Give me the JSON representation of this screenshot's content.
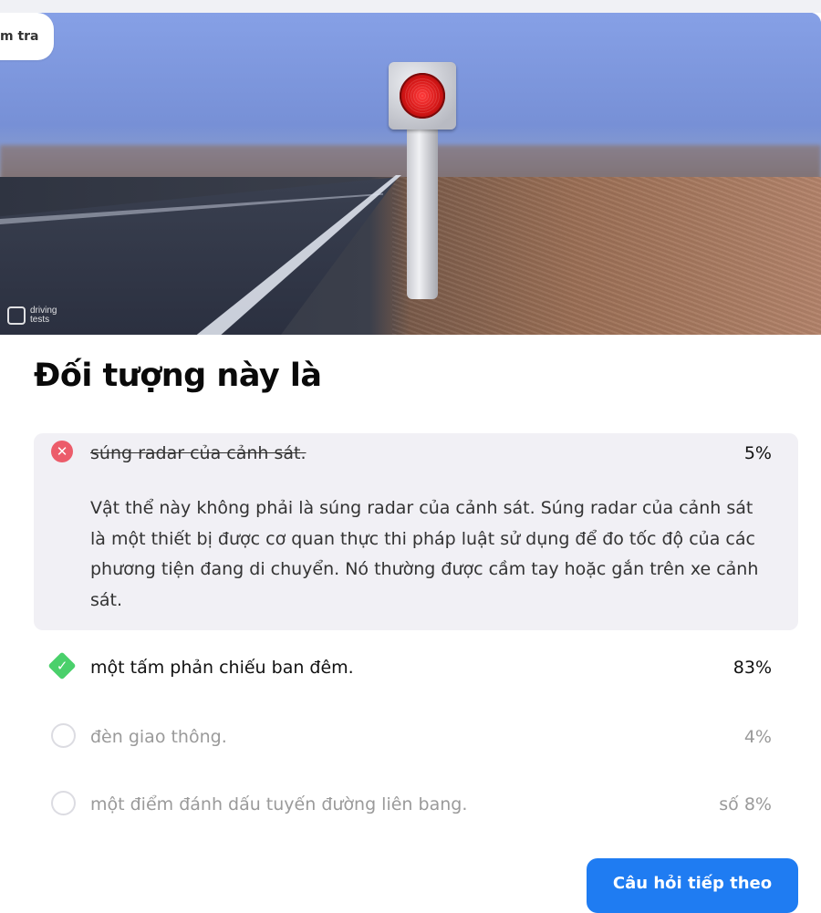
{
  "header": {
    "back_label": "m tra"
  },
  "image": {
    "watermark_line1": "driving",
    "watermark_line2": "tests"
  },
  "question": {
    "text": "Đối tượng này là"
  },
  "answers": [
    {
      "label": "súng radar của cảnh sát.",
      "percent": "5%",
      "state": "wrong",
      "explanation": "Vật thể này không phải là súng radar của cảnh sát. Súng radar của cảnh sát là một thiết bị được cơ quan thực thi pháp luật sử dụng để đo tốc độ của các phương tiện đang di chuyển. Nó thường được cầm tay hoặc gắn trên xe cảnh sát."
    },
    {
      "label": "một tấm phản chiếu ban đêm.",
      "percent": "83%",
      "state": "correct"
    },
    {
      "label": "đèn giao thông.",
      "percent": "4%",
      "state": "neutral"
    },
    {
      "label": "một điểm đánh dấu tuyến đường liên bang.",
      "percent": "số 8%",
      "state": "neutral"
    }
  ],
  "footer": {
    "next_label": "Câu hỏi tiếp theo"
  },
  "colors": {
    "accent": "#1f7cf2",
    "wrong": "#ec5c6a",
    "correct": "#4ad06b"
  }
}
